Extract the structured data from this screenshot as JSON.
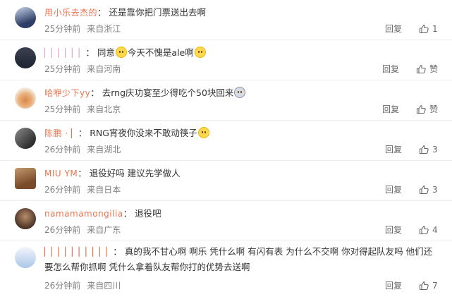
{
  "comments": [
    {
      "username": "用小乐去杰的",
      "text": "还是靠你把门票送出去啊",
      "time": "25分钟前",
      "location": "来自浙江",
      "reply": "回复",
      "likes": "1",
      "avatar_colors": [
        "#2e3d66",
        "#c9d4e8"
      ]
    },
    {
      "username": "▏▏▏▏▏▏",
      "text_before": "同意",
      "text_after": "今天不愧是ale啊",
      "time": "25分钟前",
      "location": "来自河南",
      "reply": "回复",
      "likes": "赞",
      "avatar_colors": [
        "#1d2230",
        "#3d4252"
      ]
    },
    {
      "username": "哈咿少下yy",
      "text": "去rng庆功宴至少得吃个50块回来",
      "time": "25分钟前",
      "location": "来自北京",
      "reply": "回复",
      "likes": "赞",
      "avatar_colors": [
        "#f3e7d9",
        "#d8874a"
      ]
    },
    {
      "username": "陈鹏 · ▏",
      "text": "RNG宵夜你没来不敢动筷子",
      "time": "26分钟前",
      "location": "来自湖北",
      "reply": "回复",
      "likes": "3",
      "avatar_colors": [
        "#2b2b2b",
        "#8d8d8d"
      ]
    },
    {
      "username": "MIU YM",
      "text": "退役好吗 建议先学做人",
      "time": "26分钟前",
      "location": "来自日本",
      "reply": "回复",
      "likes": "3",
      "avatar_colors": [
        "#7a4b2a",
        "#c49a6c"
      ]
    },
    {
      "username": "namamamongilia",
      "text": "退役吧",
      "time": "26分钟前",
      "location": "来自广东",
      "reply": "回复",
      "likes": "4",
      "avatar_colors": [
        "#4a3326",
        "#b88d6a"
      ]
    },
    {
      "username": "▏▏▏▏▏▏▏▏▏▏",
      "text": "真的我不甘心啊 啊乐 凭什么啊 有闪有表 为什么不交啊 你对得起队友吗 他们还要怎么帮你抓啊 凭什么拿着队友帮你打的优势去送啊",
      "time": "26分钟前",
      "location": "来自四川",
      "reply": "回复",
      "likes": "7",
      "avatar_colors": [
        "#a9c6e8",
        "#f3f6fb"
      ]
    }
  ],
  "colors": {
    "username": "#eb7350",
    "meta": "#808080",
    "action": "#666666"
  },
  "icons": {
    "like": "thumbs-up-icon",
    "emoji": "smiley-emoji-icon"
  }
}
